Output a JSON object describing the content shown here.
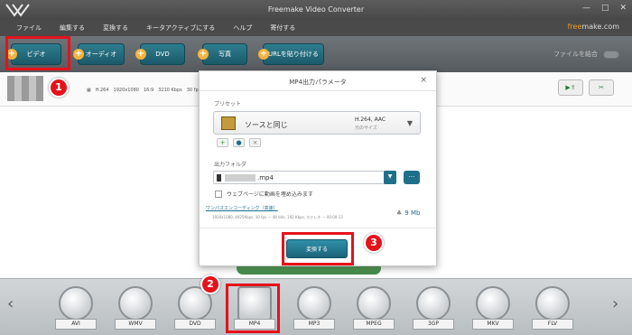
{
  "window": {
    "title": "Freemake Video Converter",
    "controls": [
      "—",
      "□",
      "✕"
    ]
  },
  "menu": {
    "items": [
      "ファイル",
      "編集する",
      "変換する",
      "キータアクティブにする",
      "ヘルプ",
      "寄付する"
    ]
  },
  "brand": {
    "prefix": "free",
    "suffix": "make.com"
  },
  "toolbar": {
    "video": "ビデオ",
    "audio": "オーディオ",
    "dvd": "DVD",
    "photo": "写真",
    "url": "URLを貼り付ける",
    "merge_label": "ファイルを結合"
  },
  "file": {
    "codec": "H.264",
    "resolution": "1920x1080",
    "aspect": "16:9",
    "bitrate": "3210 Kbps",
    "fps": "30 fps",
    "cut_label": "✂"
  },
  "dialog": {
    "title": "MP4出力パラメータ",
    "preset_label": "プリセット",
    "preset_name": "ソースと同じ",
    "preset_codec": "H.264, AAC",
    "preset_size": "元のサイズ",
    "folder_label": "出力フォルダ",
    "folder_ext": ".mp4",
    "browse": "...",
    "embed_label": "ウェブページに動画を埋め込みます",
    "onepass": "ワンパスエンコーディング（高速）",
    "params": "1920x1080, 4925Kbps, 30 fps — 48 kHz, 192 Kbps, ステレオ — 00:00:13",
    "size": "9 Mb",
    "convert": "変換する"
  },
  "formats": [
    "AVI",
    "WMV",
    "DVD",
    "MP4",
    "MP3",
    "MPEG",
    "3GP",
    "MKV",
    "FLV"
  ],
  "callouts": [
    "1",
    "2",
    "3"
  ],
  "colors": {
    "highlight": "#e5121b",
    "accent": "#1f6f8b",
    "toolbar": "#565b5f"
  }
}
